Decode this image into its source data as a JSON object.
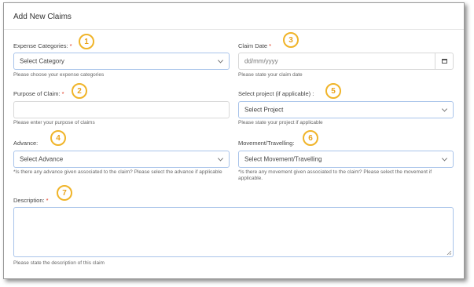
{
  "title": "Add New Claims",
  "required_mark": "*",
  "fields": {
    "expense_categories": {
      "label": "Expense Categories:",
      "required": true,
      "value": "Select Category",
      "help": "Please choose your expense categories",
      "badge": "1"
    },
    "purpose": {
      "label": "Purpose of Claim:",
      "required": true,
      "value": "",
      "help": "Please enter your purpose of claims",
      "badge": "2"
    },
    "claim_date": {
      "label": "Claim Date",
      "required": true,
      "placeholder": "dd/mm/yyyy",
      "help": "Please state your claim date",
      "badge": "3"
    },
    "advance": {
      "label": "Advance:",
      "required": false,
      "value": "Select Advance",
      "help": "*Is there any advance given associated to the claim? Please select the advance if applicable",
      "badge": "4"
    },
    "project": {
      "label": "Select project (if applicable) :",
      "required": false,
      "value": "Select Project",
      "help": "Please state your project if applicable",
      "badge": "5"
    },
    "movement": {
      "label": "Movement/Travelling:",
      "required": false,
      "value": "Select Movement/Travelling",
      "help": "*Is there any movement given associated to the claim? Please select the movement if applicable.",
      "badge": "6"
    },
    "description": {
      "label": "Description:",
      "required": true,
      "value": "",
      "help": "Please state the description of this claim",
      "badge": "7"
    }
  },
  "colors": {
    "badge": "#f0b429",
    "required": "#e0341a",
    "focus_border": "#a9c4ea"
  },
  "icons": {
    "dropdown": "chevron-down-icon",
    "calendar": "calendar-icon"
  }
}
